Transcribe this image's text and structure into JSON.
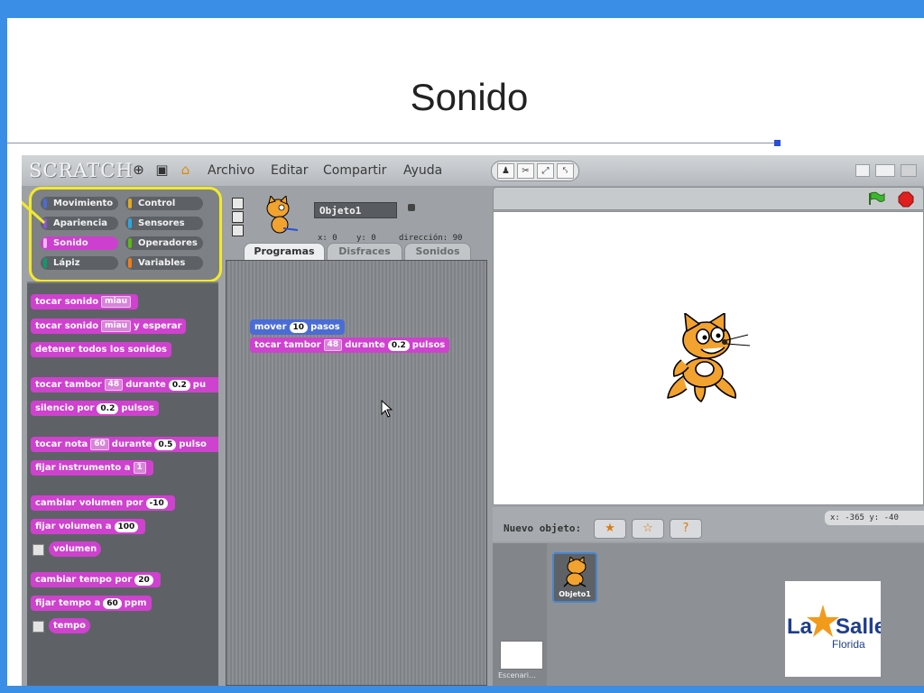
{
  "slide": {
    "title": "Sonido"
  },
  "app": {
    "logo": "SCRATCH",
    "menu": [
      "Archivo",
      "Editar",
      "Compartir",
      "Ayuda"
    ],
    "categories": [
      {
        "label": "Movimiento",
        "color": "#4a6cd4"
      },
      {
        "label": "Control",
        "color": "#e1a91a"
      },
      {
        "label": "Apariencia",
        "color": "#8a55d7"
      },
      {
        "label": "Sensores",
        "color": "#2ca5e2"
      },
      {
        "label": "Sonido",
        "color": "#cf41cf",
        "active": true
      },
      {
        "label": "Operadores",
        "color": "#5cb712"
      },
      {
        "label": "Lápiz",
        "color": "#0e9a6c"
      },
      {
        "label": "Variables",
        "color": "#ee7d16"
      }
    ],
    "blocks": {
      "b1": {
        "pre": "tocar sonido",
        "dd": "miau"
      },
      "b2": {
        "pre": "tocar sonido",
        "dd": "miau",
        "post": "y esperar"
      },
      "b3": {
        "pre": "detener todos los sonidos"
      },
      "b4": {
        "pre": "tocar tambor",
        "dd": "48",
        "mid": "durante",
        "val": "0.2",
        "post": "pu"
      },
      "b5": {
        "pre": "silencio por",
        "val": "0.2",
        "post": "pulsos"
      },
      "b6": {
        "pre": "tocar nota",
        "dd": "60",
        "mid": "durante",
        "val": "0.5",
        "post": "pulso"
      },
      "b7": {
        "pre": "fijar instrumento a",
        "dd": "1"
      },
      "b8": {
        "pre": "cambiar volumen por",
        "val": "-10"
      },
      "b9": {
        "pre": "fijar volumen a",
        "val": "100"
      },
      "b10": {
        "pre": "volumen"
      },
      "b11": {
        "pre": "cambiar tempo por",
        "val": "20"
      },
      "b12": {
        "pre": "fijar tempo a",
        "val": "60",
        "post": "ppm"
      },
      "b13": {
        "pre": "tempo"
      }
    },
    "sprite": {
      "name": "Objeto1",
      "x": "x: 0",
      "y": "y: 0",
      "direction": "dirección: 90"
    },
    "tabs": [
      "Programas",
      "Disfraces",
      "Sonidos"
    ],
    "script": {
      "move": {
        "pre": "mover",
        "val": "10",
        "post": "pasos"
      },
      "drum": {
        "pre": "tocar tambor",
        "dd": "48",
        "mid": "durante",
        "val": "0.2",
        "post": "pulsos"
      }
    },
    "stage": {
      "mouse_pos": "x: -365  y: -40",
      "new_sprite_label": "Nuevo objeto:",
      "sprite_thumb_label": "Objeto1",
      "stage_thumb_label": "Escenari..."
    }
  },
  "logo": {
    "brand": "La Salle",
    "sub": "Florida"
  }
}
